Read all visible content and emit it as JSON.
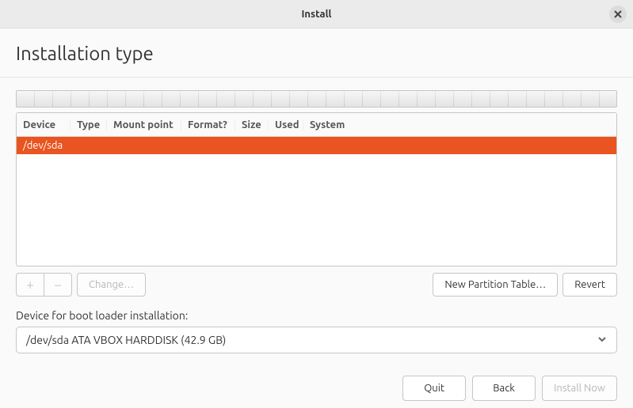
{
  "window": {
    "title": "Install"
  },
  "page": {
    "heading": "Installation type"
  },
  "table": {
    "headers": {
      "device": "Device",
      "type": "Type",
      "mount": "Mount point",
      "format": "Format?",
      "size": "Size",
      "used": "Used",
      "system": "System"
    },
    "rows": [
      {
        "device": "/dev/sda",
        "selected": true
      }
    ]
  },
  "toolbar": {
    "add": "+",
    "remove": "−",
    "change": "Change…",
    "new_partition_table": "New Partition Table…",
    "revert": "Revert"
  },
  "bootloader": {
    "label": "Device for boot loader installation:",
    "selected": "/dev/sda  ATA VBOX HARDDISK (42.9 GB)"
  },
  "footer": {
    "quit": "Quit",
    "back": "Back",
    "install_now": "Install Now"
  }
}
